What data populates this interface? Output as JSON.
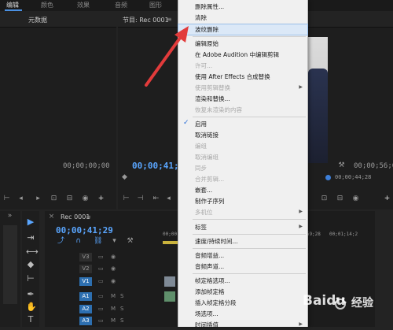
{
  "workspace_tabs": [
    "编辑",
    "颜色",
    "效果",
    "音频",
    "图形"
  ],
  "source_panel": {
    "title": "元数据",
    "timecode": "00;00;00;00"
  },
  "program_panel": {
    "title": "节目: Rec 0001",
    "timecode_current": "00;00;41;29",
    "timecode_right": "00;00;56;03",
    "timecode_small": "00;00;44;28"
  },
  "timeline": {
    "title": "Rec 0001",
    "timecode": "00;00;41;29",
    "ruler_labels": [
      "00;00",
      "00;59;28",
      "00;01;14;2"
    ],
    "tracks": [
      {
        "name": "V3",
        "active": false
      },
      {
        "name": "V2",
        "active": false
      },
      {
        "name": "V1",
        "active": true
      },
      {
        "name": "A1",
        "active": true
      },
      {
        "name": "A2",
        "active": true
      },
      {
        "name": "A3",
        "active": true
      }
    ],
    "track_buttons": [
      "M",
      "S"
    ]
  },
  "context_menu": {
    "items": [
      {
        "label": "删除属性...",
        "state": "normal"
      },
      {
        "label": "清除",
        "state": "normal"
      },
      {
        "label": "波纹删除",
        "state": "highlighted"
      },
      {
        "label": "编辑原始",
        "state": "normal"
      },
      {
        "label": "在 Adobe Audition 中编辑剪辑",
        "state": "normal"
      },
      {
        "label": "许可...",
        "state": "disabled"
      },
      {
        "label": "使用 After Effects 合成替换",
        "state": "normal"
      },
      {
        "label": "使用剪辑替换",
        "state": "disabled",
        "submenu": true
      },
      {
        "label": "渲染和替换...",
        "state": "normal"
      },
      {
        "label": "恢复未渲染的内容",
        "state": "disabled"
      },
      {
        "label": "启用",
        "state": "checked"
      },
      {
        "label": "取消链接",
        "state": "normal"
      },
      {
        "label": "编组",
        "state": "disabled"
      },
      {
        "label": "取消编组",
        "state": "disabled"
      },
      {
        "label": "同步",
        "state": "disabled"
      },
      {
        "label": "合并剪辑...",
        "state": "disabled"
      },
      {
        "label": "嵌套...",
        "state": "normal"
      },
      {
        "label": "制作子序列",
        "state": "normal"
      },
      {
        "label": "多机位",
        "state": "disabled",
        "submenu": true
      },
      {
        "label": "标签",
        "state": "normal",
        "submenu": true
      },
      {
        "label": "速度/持续时间...",
        "state": "normal"
      },
      {
        "label": "音频增益...",
        "state": "normal"
      },
      {
        "label": "音频声道...",
        "state": "normal"
      },
      {
        "label": "帧定格选项...",
        "state": "normal"
      },
      {
        "label": "添加帧定格",
        "state": "normal"
      },
      {
        "label": "插入帧定格分段",
        "state": "normal"
      },
      {
        "label": "场选项...",
        "state": "normal"
      },
      {
        "label": "时间插值",
        "state": "normal",
        "submenu": true
      }
    ]
  },
  "watermark": {
    "brand": "Baidu",
    "product": "经验"
  },
  "colors": {
    "accent_blue": "#4a90e2",
    "annotation_red": "#e23b3b",
    "menu_bg": "#f0f0f0",
    "menu_highlight": "#dbe8f7"
  }
}
